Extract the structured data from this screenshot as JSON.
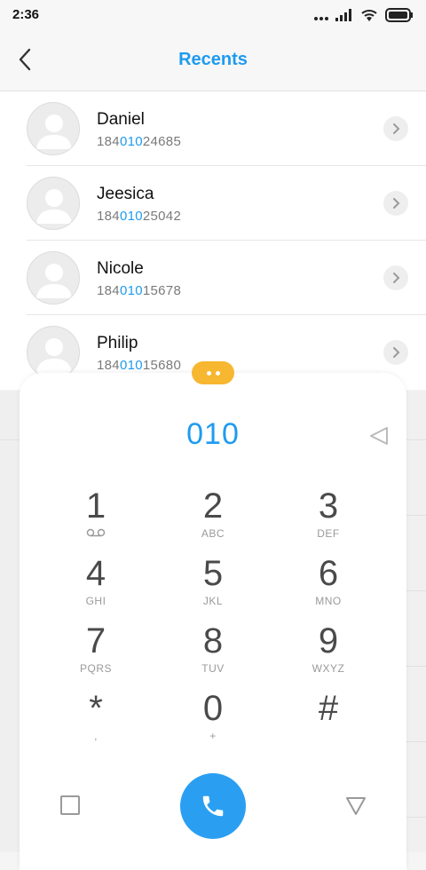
{
  "status_bar": {
    "time": "2:36"
  },
  "header": {
    "title": "Recents"
  },
  "contacts": [
    {
      "name": "Daniel",
      "number_prefix": "184",
      "number_match": "010",
      "number_suffix": "24685"
    },
    {
      "name": "Jeesica",
      "number_prefix": "184",
      "number_match": "010",
      "number_suffix": "25042"
    },
    {
      "name": "Nicole",
      "number_prefix": "184",
      "number_match": "010",
      "number_suffix": "15678"
    },
    {
      "name": "Philip",
      "number_prefix": "184",
      "number_match": "010",
      "number_suffix": "15680"
    }
  ],
  "dialpad": {
    "dialed": "010",
    "keys": [
      {
        "digit": "1",
        "letters": ""
      },
      {
        "digit": "2",
        "letters": "ABC"
      },
      {
        "digit": "3",
        "letters": "DEF"
      },
      {
        "digit": "4",
        "letters": "GHI"
      },
      {
        "digit": "5",
        "letters": "JKL"
      },
      {
        "digit": "6",
        "letters": "MNO"
      },
      {
        "digit": "7",
        "letters": "PQRS"
      },
      {
        "digit": "8",
        "letters": "TUV"
      },
      {
        "digit": "9",
        "letters": "WXYZ"
      },
      {
        "digit": "*",
        "letters": ","
      },
      {
        "digit": "0",
        "letters": "+"
      },
      {
        "digit": "#",
        "letters": ""
      }
    ]
  },
  "colors": {
    "accent": "#1e9bf0",
    "call_button": "#2a9ff2",
    "handle": "#f7b731"
  },
  "icons": {
    "back": "chevron-left-icon",
    "detail": "chevron-right-icon",
    "backspace": "backspace-triangle-icon",
    "voicemail": "voicemail-icon",
    "call": "phone-icon",
    "recents_square": "square-icon",
    "nav_triangle": "triangle-down-icon"
  }
}
